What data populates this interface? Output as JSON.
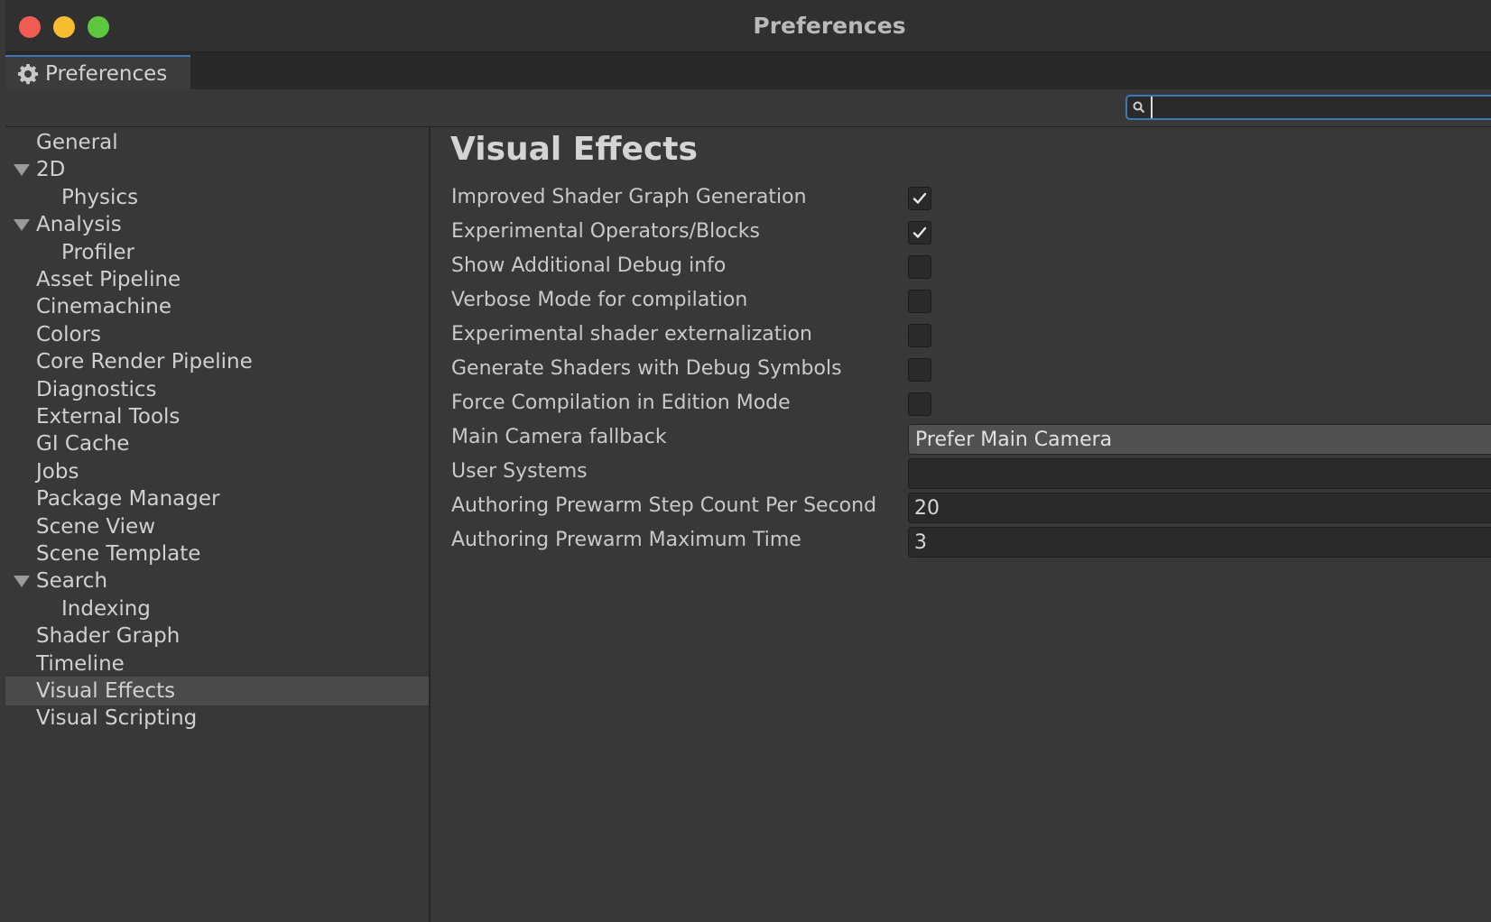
{
  "window": {
    "title": "Preferences"
  },
  "tab": {
    "label": "Preferences",
    "icon": "gear-icon"
  },
  "search": {
    "value": "",
    "placeholder": ""
  },
  "sidebar": {
    "items": [
      {
        "label": "General",
        "level": 0,
        "expandable": false
      },
      {
        "label": "2D",
        "level": 0,
        "expandable": true
      },
      {
        "label": "Physics",
        "level": 1,
        "expandable": false
      },
      {
        "label": "Analysis",
        "level": 0,
        "expandable": true
      },
      {
        "label": "Profiler",
        "level": 1,
        "expandable": false
      },
      {
        "label": "Asset Pipeline",
        "level": 0,
        "expandable": false
      },
      {
        "label": "Cinemachine",
        "level": 0,
        "expandable": false
      },
      {
        "label": "Colors",
        "level": 0,
        "expandable": false
      },
      {
        "label": "Core Render Pipeline",
        "level": 0,
        "expandable": false
      },
      {
        "label": "Diagnostics",
        "level": 0,
        "expandable": false
      },
      {
        "label": "External Tools",
        "level": 0,
        "expandable": false
      },
      {
        "label": "GI Cache",
        "level": 0,
        "expandable": false
      },
      {
        "label": "Jobs",
        "level": 0,
        "expandable": false
      },
      {
        "label": "Package Manager",
        "level": 0,
        "expandable": false
      },
      {
        "label": "Scene View",
        "level": 0,
        "expandable": false
      },
      {
        "label": "Scene Template",
        "level": 0,
        "expandable": false
      },
      {
        "label": "Search",
        "level": 0,
        "expandable": true
      },
      {
        "label": "Indexing",
        "level": 1,
        "expandable": false
      },
      {
        "label": "Shader Graph",
        "level": 0,
        "expandable": false
      },
      {
        "label": "Timeline",
        "level": 0,
        "expandable": false
      },
      {
        "label": "Visual Effects",
        "level": 0,
        "expandable": false,
        "selected": true
      },
      {
        "label": "Visual Scripting",
        "level": 0,
        "expandable": false
      }
    ]
  },
  "main": {
    "title": "Visual Effects",
    "settings": [
      {
        "label": "Improved Shader Graph Generation",
        "type": "checkbox",
        "checked": true
      },
      {
        "label": "Experimental Operators/Blocks",
        "type": "checkbox",
        "checked": true
      },
      {
        "label": "Show Additional Debug info",
        "type": "checkbox",
        "checked": false
      },
      {
        "label": "Verbose Mode for compilation",
        "type": "checkbox",
        "checked": false
      },
      {
        "label": "Experimental shader externalization",
        "type": "checkbox",
        "checked": false
      },
      {
        "label": "Generate Shaders with Debug Symbols",
        "type": "checkbox",
        "checked": false
      },
      {
        "label": "Force Compilation in Edition Mode",
        "type": "checkbox",
        "checked": false
      },
      {
        "label": "Main Camera fallback",
        "type": "dropdown",
        "value": "Prefer Main Camera"
      },
      {
        "label": "User Systems",
        "type": "text",
        "value": ""
      },
      {
        "label": "Authoring Prewarm Step Count Per Second",
        "type": "text",
        "value": "20"
      },
      {
        "label": "Authoring Prewarm Maximum Time",
        "type": "text",
        "value": "3"
      }
    ]
  },
  "colors": {
    "accent": "#3a79bb",
    "close": "#ee5c53",
    "minimize": "#f5bd2f",
    "zoom": "#5dc73f"
  }
}
